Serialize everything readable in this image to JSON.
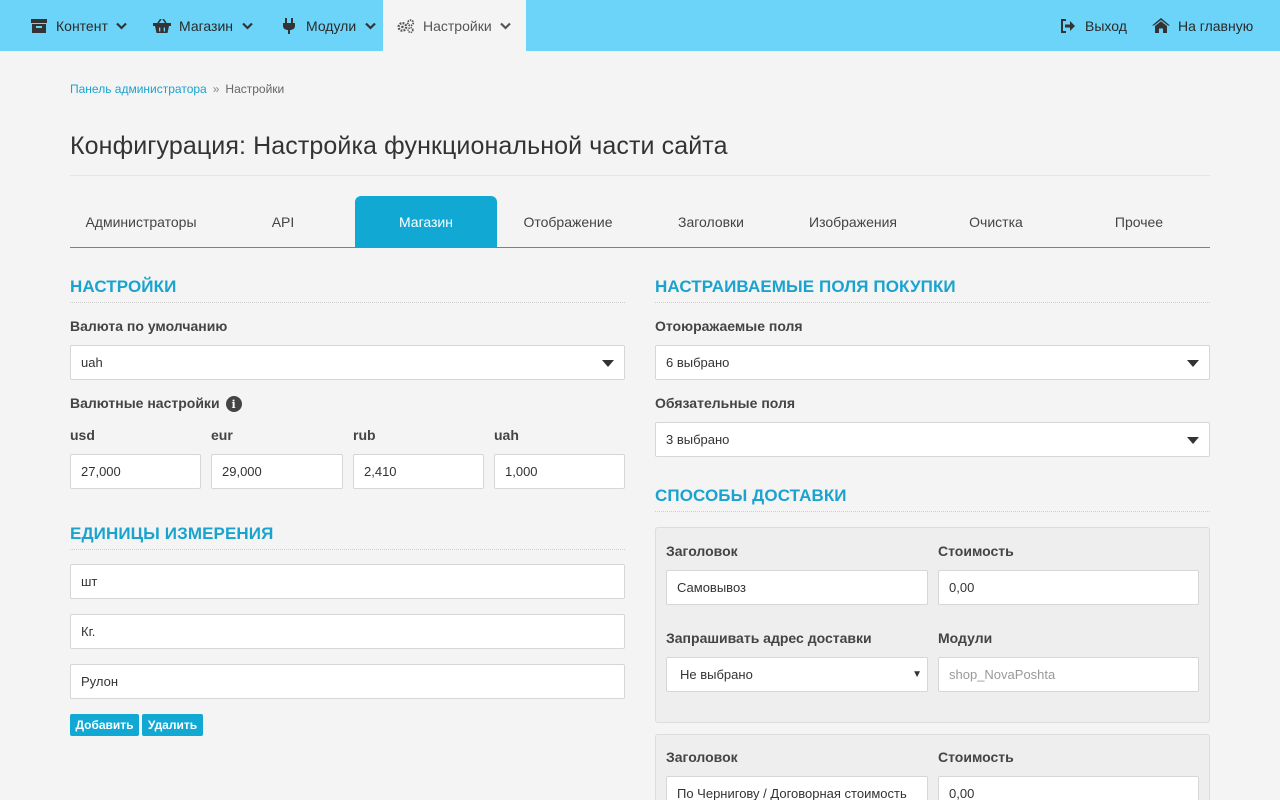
{
  "nav": {
    "content": "Контент",
    "shop": "Магазин",
    "modules": "Модули",
    "settings": "Настройки",
    "logout": "Выход",
    "home": "На главную"
  },
  "breadcrumb": {
    "admin": "Панель администратора",
    "sep": "»",
    "current": "Настройки"
  },
  "page_title": "Конфигурация: Настройка функциональной части сайта",
  "tabs": [
    "Администраторы",
    "API",
    "Магазин",
    "Отображение",
    "Заголовки",
    "Изображения",
    "Очистка",
    "Прочее"
  ],
  "settings": {
    "title": "НАСТРОЙКИ",
    "currency_label": "Валюта по умолчанию",
    "currency_value": "uah",
    "rates_label": "Валютные настройки",
    "info_glyph": "i",
    "rates": [
      {
        "code": "usd",
        "value": "27,000"
      },
      {
        "code": "eur",
        "value": "29,000"
      },
      {
        "code": "rub",
        "value": "2,410"
      },
      {
        "code": "uah",
        "value": "1,000"
      }
    ]
  },
  "units": {
    "title": "ЕДИНИЦЫ ИЗМЕРЕНИЯ",
    "items": [
      "шт",
      "Кг.",
      "Рулон"
    ],
    "add": "Добавить",
    "remove": "Удалить"
  },
  "purchase_fields": {
    "title": "НАСТРАИВАЕМЫЕ ПОЛЯ ПОКУПКИ",
    "shown_label": "Отоюражаемые поля",
    "shown_value": "6 выбрано",
    "required_label": "Обязательные поля",
    "required_value": "3 выбрано"
  },
  "delivery": {
    "title": "СПОСОБЫ ДОСТАВКИ",
    "methods": [
      {
        "title_label": "Заголовок",
        "title_value": "Самовывоз",
        "cost_label": "Стоимость",
        "cost_value": "0,00",
        "address_label": "Запрашивать адрес доставки",
        "address_value": "Не выбрано",
        "modules_label": "Модули",
        "modules_placeholder": "shop_NovaPoshta"
      },
      {
        "title_label": "Заголовок",
        "title_value": "По Чернигову / Договорная стоимость",
        "cost_label": "Стоимость",
        "cost_value": "0,00"
      }
    ]
  },
  "colors": {
    "topbar": "#6cd4f8",
    "accent": "#11a9d4",
    "link": "#1aa3cf"
  }
}
